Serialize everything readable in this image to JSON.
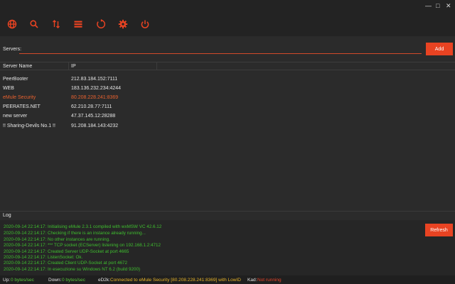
{
  "window": {
    "minimize": "—",
    "maximize": "□",
    "close": "✕"
  },
  "toolbar": {
    "accent_color": "#e84322",
    "icons": [
      "globe-icon",
      "search-icon",
      "transfer-icon",
      "list-icon",
      "refresh-circle-icon",
      "gear-icon",
      "power-icon"
    ]
  },
  "servers": {
    "label": "Servers:",
    "input_value": "",
    "add_label": "Add",
    "columns": [
      "Server Name",
      "IP"
    ],
    "rows": [
      {
        "name": "PeerBooter",
        "ip": "212.83.184.152:7111",
        "selected": false
      },
      {
        "name": "WEB",
        "ip": "183.136.232.234:4244",
        "selected": false
      },
      {
        "name": "eMule Security",
        "ip": "80.208.228.241:8369",
        "selected": true
      },
      {
        "name": "PEERATES.NET",
        "ip": "62.210.28.77:7111",
        "selected": false
      },
      {
        "name": "new server",
        "ip": "47.37.145.12:28288",
        "selected": false
      },
      {
        "name": "!! Sharing-Devils No.1 !!",
        "ip": "91.208.184.143:4232",
        "selected": false
      }
    ]
  },
  "log": {
    "label": "Log",
    "refresh_label": "Refresh",
    "lines": [
      "2020-09-14 22:14:17: Initialising eMule 2.3.1 compiled with wxMSW VC 42.6.12",
      "2020-09-14 22:14:17: Checking if there is an instance already running...",
      "2020-09-14 22:14:17: No other instances are running.",
      "2020-09-14 22:14:17: *** TCP socket (ECServer) listening on 192.168.1.2:4712",
      "2020-09-14 22:14:17: Created Server UDP-Socket at port 4665",
      "2020-09-14 22:14:17: ListenSocket: Ok.",
      "2020-09-14 22:14:17: Created Client UDP-Socket at port 4672",
      "2020-09-14 22:14:17: In esecuzione su Windows NT 6.2 (build 9200)"
    ]
  },
  "status": {
    "up_label": "Up:",
    "up_value": "0 bytes/sec",
    "down_label": "Down:",
    "down_value": "0 bytes/sec",
    "ed2k_label": "eD2k:",
    "ed2k_value": "Connected to eMule Security [80.208.228.241:8369] with LowID",
    "kad_label": "Kad:",
    "kad_value": "Not running"
  }
}
